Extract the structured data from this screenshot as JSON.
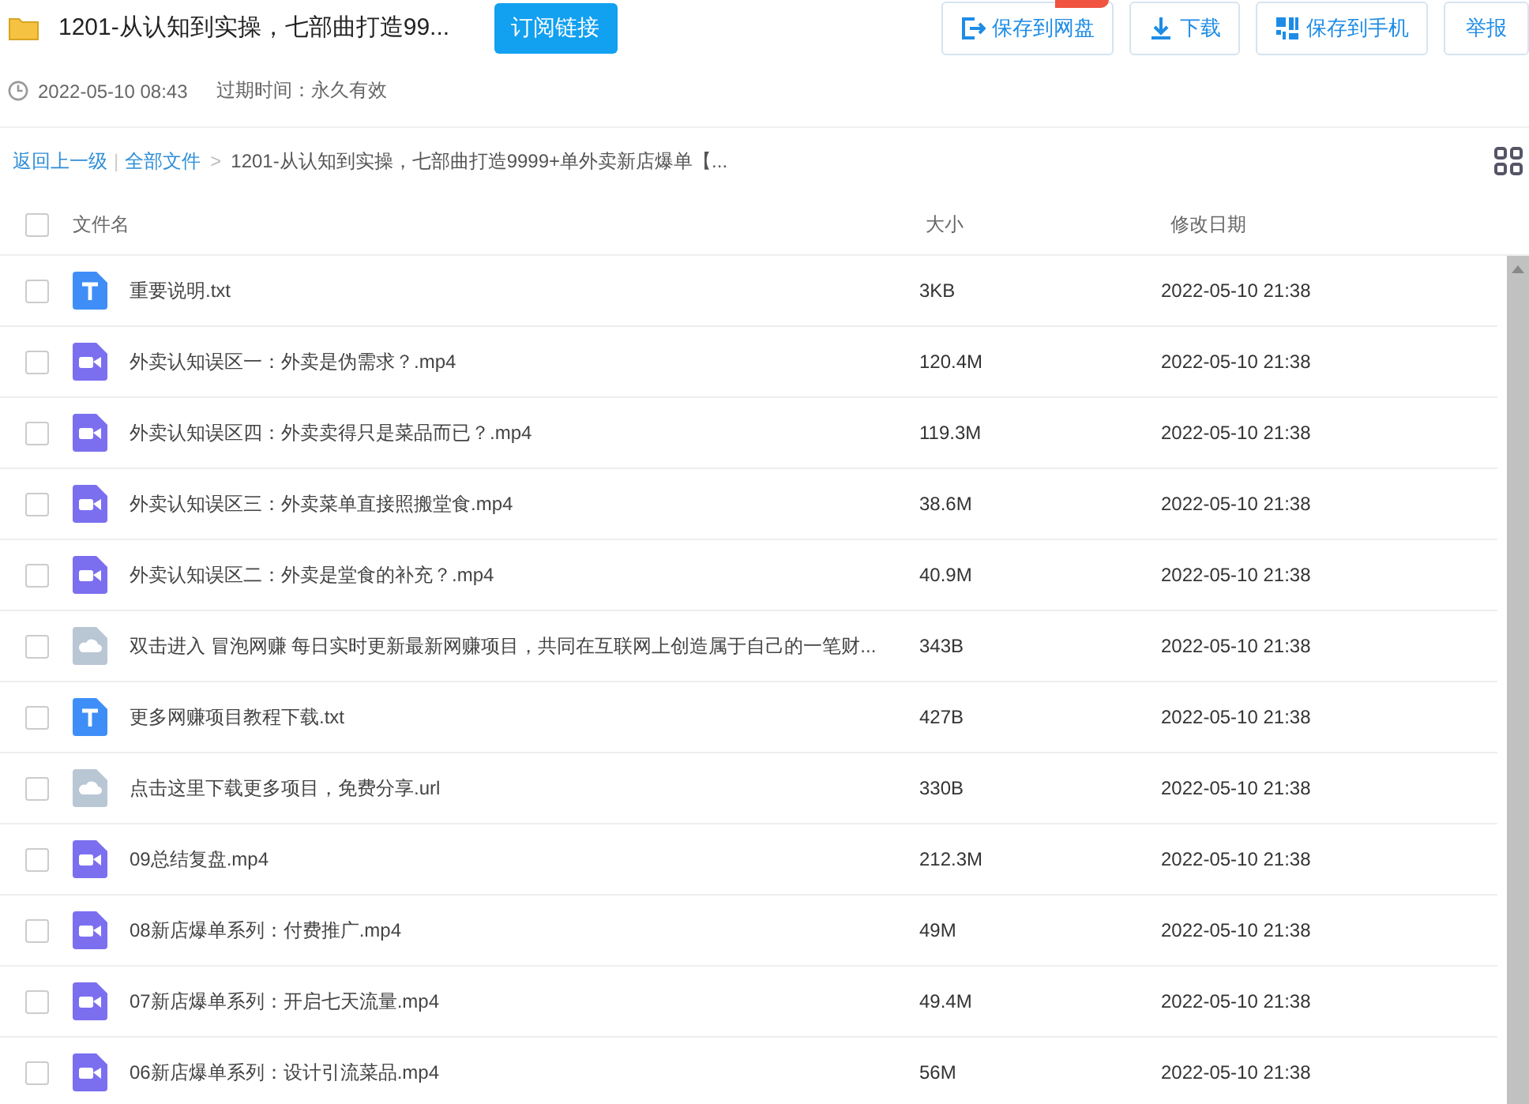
{
  "header": {
    "title": "1201-从认知到实操，七部曲打造99...",
    "subscribe_button": "订阅链接",
    "actions": [
      {
        "kind": "save",
        "label": "保存到网盘",
        "badge": true
      },
      {
        "kind": "download",
        "label": "下载"
      },
      {
        "kind": "phone",
        "label": "保存到手机"
      },
      {
        "kind": "report",
        "label": "举报"
      }
    ]
  },
  "meta": {
    "created": "2022-05-10 08:43",
    "expiry": "过期时间：永久有效"
  },
  "breadcrumb": {
    "back": "返回上一级",
    "separator": "|",
    "root": "全部文件",
    "arrow": ">",
    "current": "1201-从认知到实操，七部曲打造9999+单外卖新店爆单【..."
  },
  "table": {
    "select_all_checked": false,
    "columns": [
      "文件名",
      "大小",
      "修改日期"
    ],
    "rows": [
      {
        "kind": "txt",
        "name": "重要说明.txt",
        "size": "3KB",
        "date": "2022-05-10 21:38",
        "checked": false
      },
      {
        "kind": "video",
        "name": "外卖认知误区一：外卖是伪需求？.mp4",
        "size": "120.4M",
        "date": "2022-05-10 21:38",
        "checked": false
      },
      {
        "kind": "video",
        "name": "外卖认知误区四：外卖卖得只是菜品而已？.mp4",
        "size": "119.3M",
        "date": "2022-05-10 21:38",
        "checked": false
      },
      {
        "kind": "video",
        "name": "外卖认知误区三：外卖菜单直接照搬堂食.mp4",
        "size": "38.6M",
        "date": "2022-05-10 21:38",
        "checked": false
      },
      {
        "kind": "video",
        "name": "外卖认知误区二：外卖是堂食的补充？.mp4",
        "size": "40.9M",
        "date": "2022-05-10 21:38",
        "checked": false
      },
      {
        "kind": "link",
        "name": "双击进入 冒泡网赚 每日实时更新最新网赚项目，共同在互联网上创造属于自己的一笔财...",
        "size": "343B",
        "date": "2022-05-10 21:38",
        "checked": false
      },
      {
        "kind": "txt",
        "name": "更多网赚项目教程下载.txt",
        "size": "427B",
        "date": "2022-05-10 21:38",
        "checked": false
      },
      {
        "kind": "link",
        "name": "点击这里下载更多项目，免费分享.url",
        "size": "330B",
        "date": "2022-05-10 21:38",
        "checked": false
      },
      {
        "kind": "video",
        "name": "09总结复盘.mp4",
        "size": "212.3M",
        "date": "2022-05-10 21:38",
        "checked": false
      },
      {
        "kind": "video",
        "name": "08新店爆单系列：付费推广.mp4",
        "size": "49M",
        "date": "2022-05-10 21:38",
        "checked": false
      },
      {
        "kind": "video",
        "name": "07新店爆单系列：开启七天流量.mp4",
        "size": "49.4M",
        "date": "2022-05-10 21:38",
        "checked": false
      },
      {
        "kind": "video",
        "name": "06新店爆单系列：设计引流菜品.mp4",
        "size": "56M",
        "date": "2022-05-10 21:38",
        "checked": false
      }
    ]
  }
}
